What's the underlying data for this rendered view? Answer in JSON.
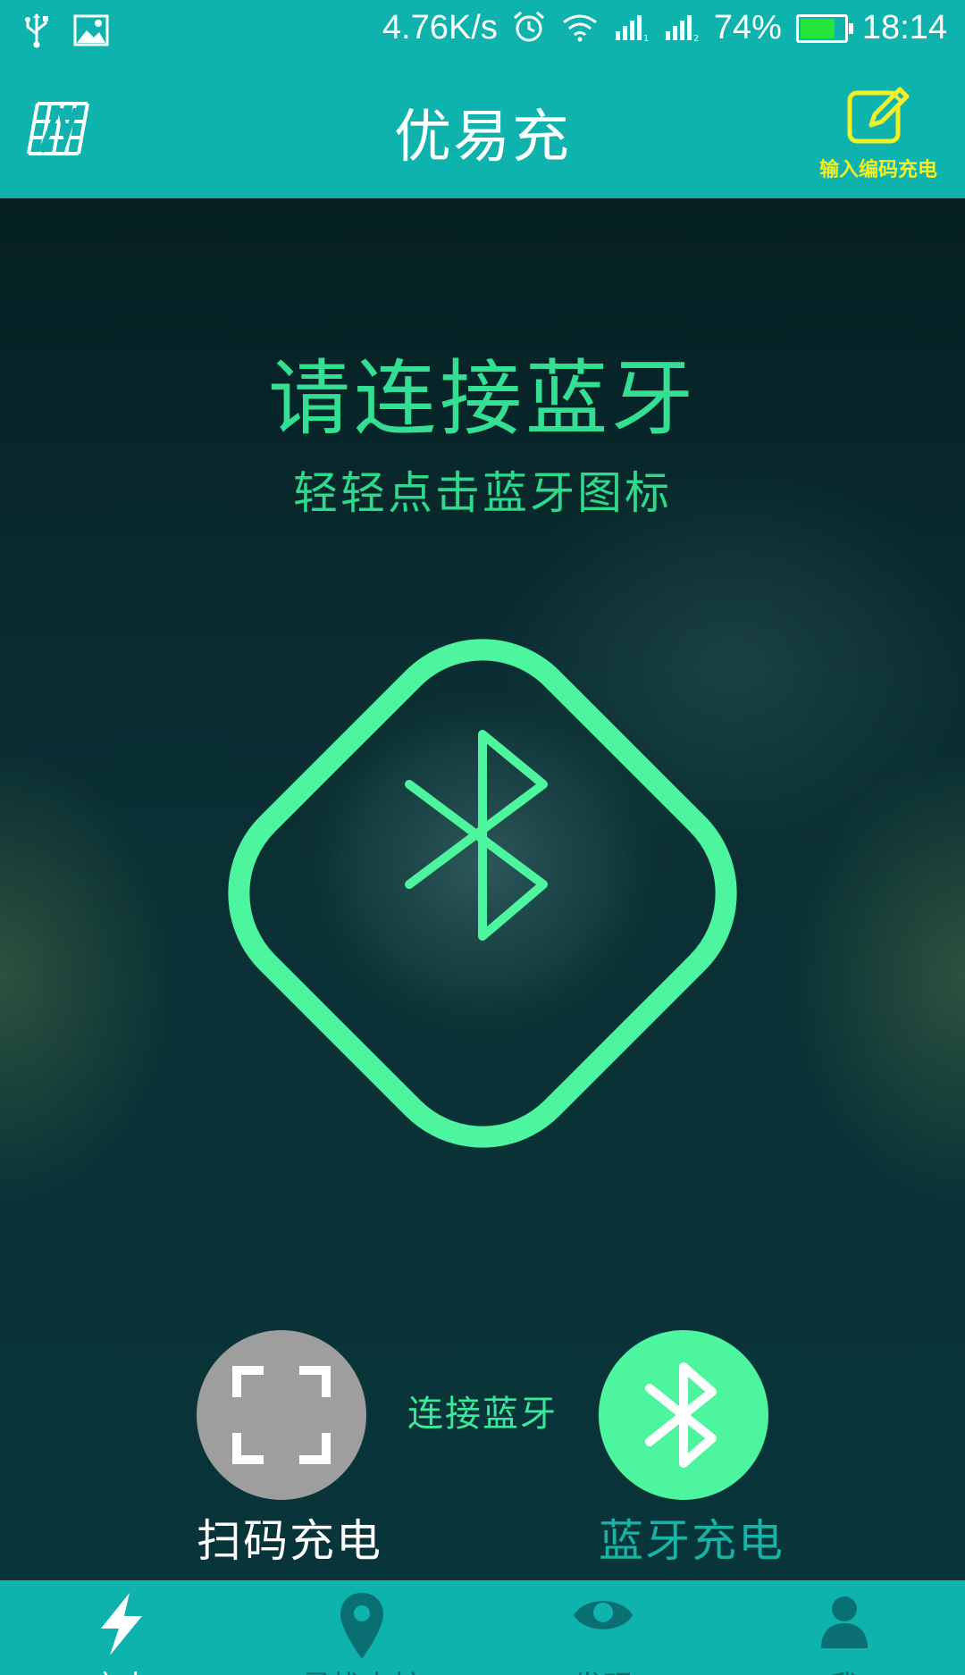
{
  "status_bar": {
    "speed": "4.76K/s",
    "battery_percent": "74%",
    "battery_level": 0.74,
    "time": "18:14",
    "icons": [
      "usb-icon",
      "image-icon",
      "alarm-icon",
      "wifi-icon",
      "signal-1-icon",
      "signal-2-icon",
      "battery-icon"
    ]
  },
  "app_bar": {
    "title": "优易充",
    "code_entry_label": "输入编码充电"
  },
  "main": {
    "headline": "请连接蓝牙",
    "subline": "轻轻点击蓝牙图标",
    "bt_button_label": "连接蓝牙"
  },
  "actions": {
    "scan_label": "扫码充电",
    "bluetooth_label": "蓝牙充电"
  },
  "bottom_nav": {
    "tabs": [
      {
        "label": "充电",
        "icon": "lightning-icon",
        "active": true
      },
      {
        "label": "寻找电桩",
        "icon": "map-pin-icon",
        "active": false
      },
      {
        "label": "发现",
        "icon": "eye-icon",
        "active": false
      },
      {
        "label": "我",
        "icon": "person-icon",
        "active": false
      }
    ]
  },
  "colors": {
    "primary": "#0fb3ad",
    "accent_green": "#4ef59f",
    "highlight_yellow": "#f2ef27",
    "background_dark": "#062e33"
  }
}
